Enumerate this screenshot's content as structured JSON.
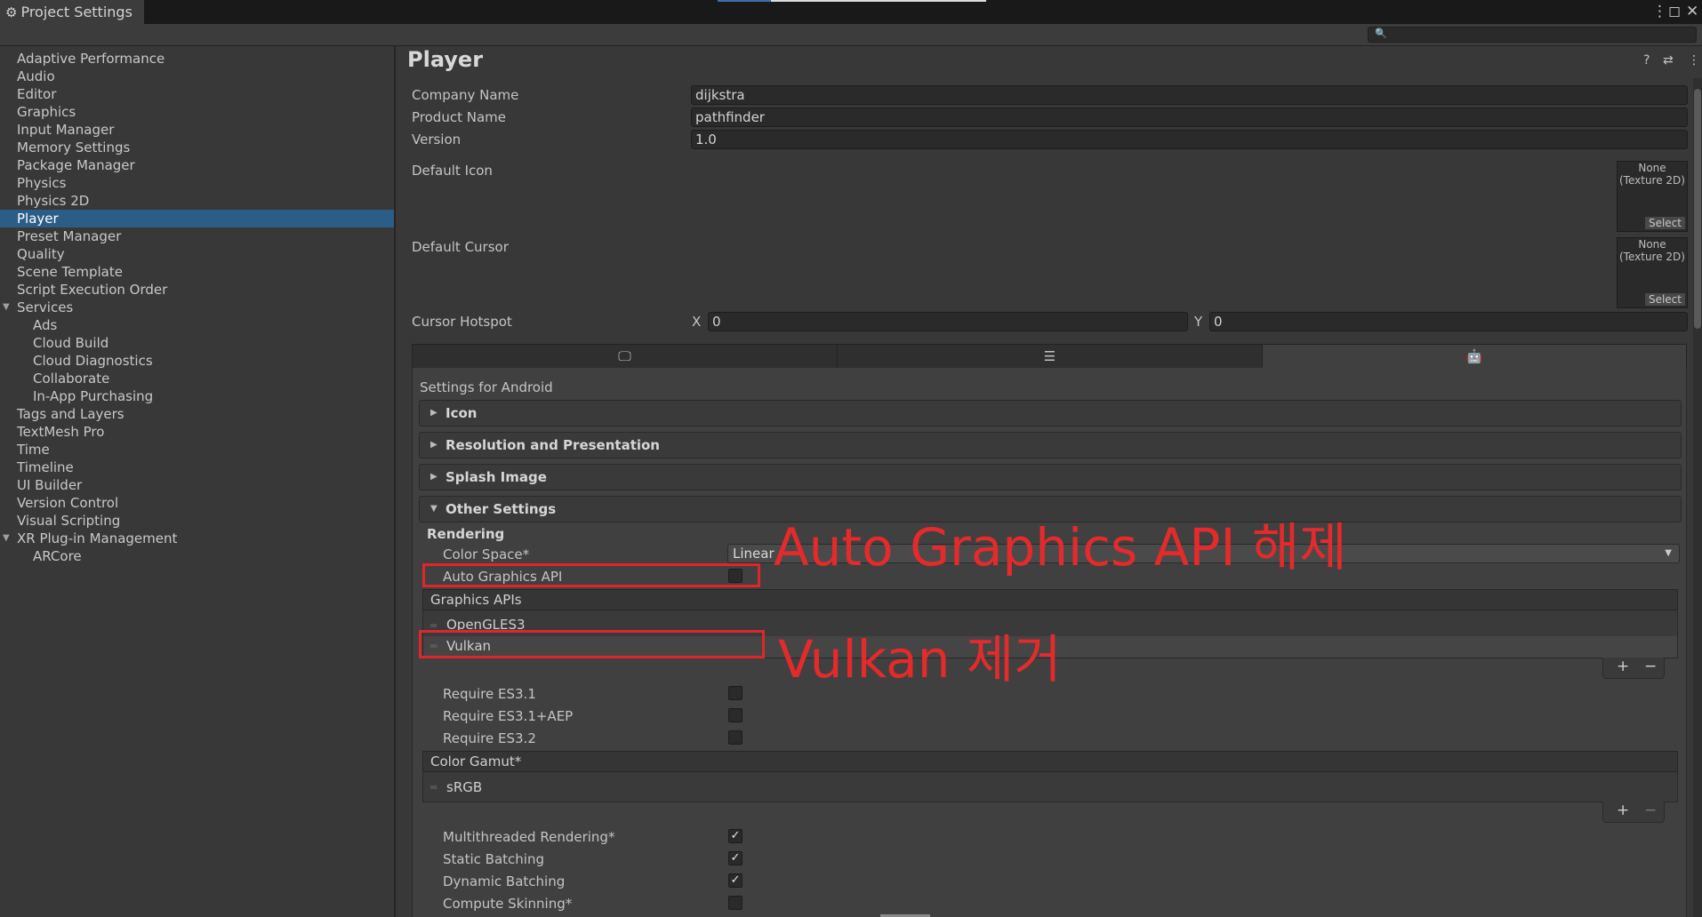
{
  "window": {
    "title": "Project Settings",
    "search_placeholder": ""
  },
  "sidebar": {
    "items": [
      {
        "label": "Adaptive Performance"
      },
      {
        "label": "Audio"
      },
      {
        "label": "Editor"
      },
      {
        "label": "Graphics"
      },
      {
        "label": "Input Manager"
      },
      {
        "label": "Memory Settings"
      },
      {
        "label": "Package Manager"
      },
      {
        "label": "Physics"
      },
      {
        "label": "Physics 2D"
      },
      {
        "label": "Player"
      },
      {
        "label": "Preset Manager"
      },
      {
        "label": "Quality"
      },
      {
        "label": "Scene Template"
      },
      {
        "label": "Script Execution Order"
      },
      {
        "label": "Services"
      },
      {
        "label": "Ads"
      },
      {
        "label": "Cloud Build"
      },
      {
        "label": "Cloud Diagnostics"
      },
      {
        "label": "Collaborate"
      },
      {
        "label": "In-App Purchasing"
      },
      {
        "label": "Tags and Layers"
      },
      {
        "label": "TextMesh Pro"
      },
      {
        "label": "Time"
      },
      {
        "label": "Timeline"
      },
      {
        "label": "UI Builder"
      },
      {
        "label": "Version Control"
      },
      {
        "label": "Visual Scripting"
      },
      {
        "label": "XR Plug-in Management"
      },
      {
        "label": "ARCore"
      }
    ],
    "selected": "Player"
  },
  "player": {
    "title": "Player",
    "company_name_label": "Company Name",
    "company_name": "dijkstra",
    "product_name_label": "Product Name",
    "product_name": "pathfinder",
    "version_label": "Version",
    "version": "1.0",
    "default_icon_label": "Default Icon",
    "default_cursor_label": "Default Cursor",
    "texture_none": "None",
    "texture_type": "(Texture 2D)",
    "select_label": "Select",
    "cursor_hotspot_label": "Cursor Hotspot",
    "hotspot_x_label": "X",
    "hotspot_x": "0",
    "hotspot_y_label": "Y",
    "hotspot_y": "0"
  },
  "platform_tabs": [
    {
      "icon": "monitor-icon"
    },
    {
      "icon": "webgl-icon"
    },
    {
      "icon": "android-icon",
      "active": true
    }
  ],
  "android": {
    "settings_title": "Settings for Android",
    "sections": [
      "Icon",
      "Resolution and Presentation",
      "Splash Image",
      "Other Settings"
    ],
    "rendering_header": "Rendering",
    "color_space_label": "Color Space*",
    "color_space_value": "Linear",
    "auto_graphics_label": "Auto Graphics API",
    "auto_graphics_checked": false,
    "graphics_apis_header": "Graphics APIs",
    "graphics_apis": [
      "OpenGLES3",
      "Vulkan"
    ],
    "require_es31_label": "Require ES3.1",
    "require_es31_aep_label": "Require ES3.1+AEP",
    "require_es32_label": "Require ES3.2",
    "color_gamut_header": "Color Gamut*",
    "color_gamut_items": [
      "sRGB"
    ],
    "multithreaded_label": "Multithreaded Rendering*",
    "static_batching_label": "Static Batching",
    "dynamic_batching_label": "Dynamic Batching",
    "compute_skinning_label": "Compute Skinning*",
    "checkmark": "✓",
    "plus": "+",
    "minus": "−"
  },
  "annotations": {
    "auto_graphics": "Auto Graphics API 해제",
    "vulkan": "Vulkan 제거"
  },
  "colors": {
    "selection": "#2c5d87",
    "annotation": "#e0252b",
    "background": "#383838"
  }
}
